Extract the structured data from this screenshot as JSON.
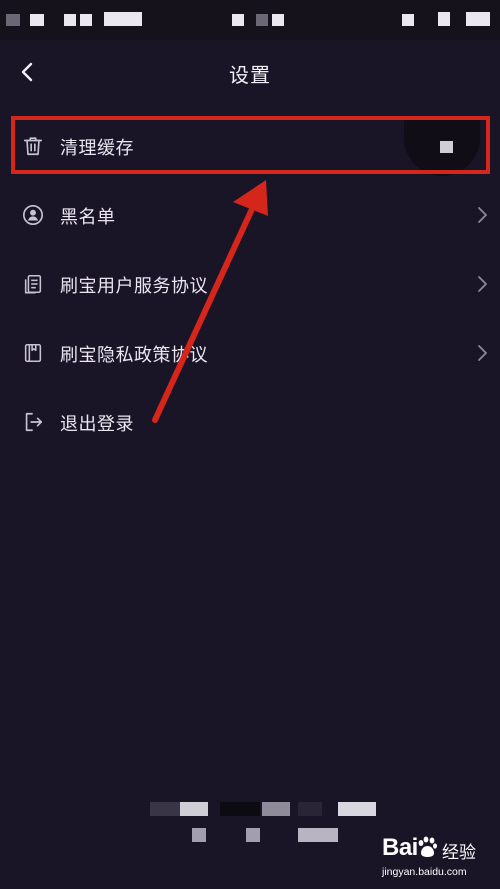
{
  "header": {
    "title": "设置",
    "back_icon": "chevron-left-icon"
  },
  "menu": [
    {
      "label": "清理缓存",
      "icon": "trash-icon",
      "has_chevron": false,
      "highlighted": true
    },
    {
      "label": "黑名单",
      "icon": "block-user-icon",
      "has_chevron": true
    },
    {
      "label": "刷宝用户服务协议",
      "icon": "document-icon",
      "has_chevron": true
    },
    {
      "label": "刷宝隐私政策协议",
      "icon": "book-icon",
      "has_chevron": true
    },
    {
      "label": "退出登录",
      "icon": "logout-icon",
      "has_chevron": false
    }
  ],
  "watermark": {
    "brand": "Bai",
    "brand_suffix": "经验",
    "domain": "jingyan.baidu.com"
  },
  "colors": {
    "background": "#1a1427",
    "annotation_red": "#d4261b",
    "text": "#e9e6f0"
  }
}
